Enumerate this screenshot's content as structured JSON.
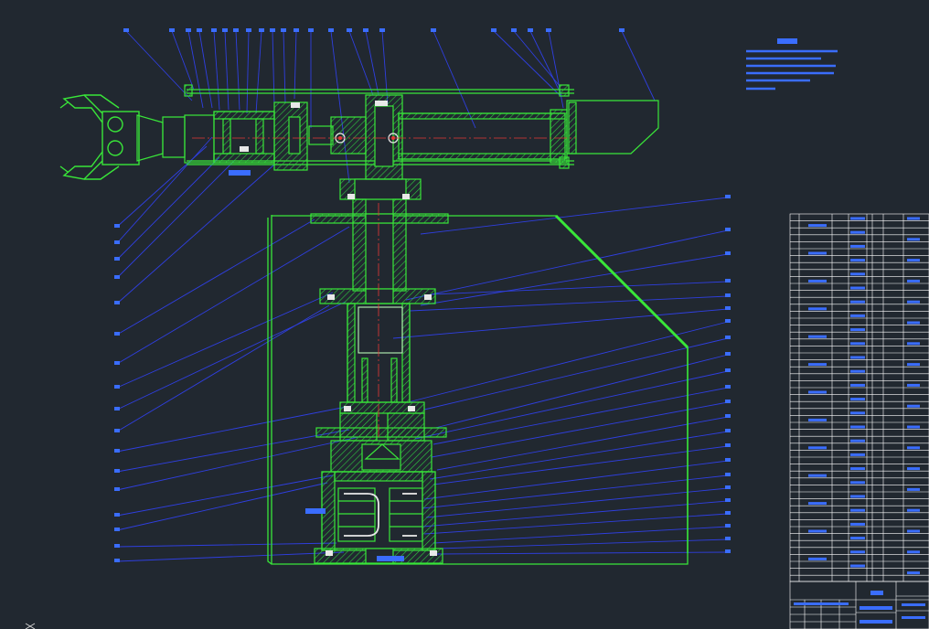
{
  "viewport": {
    "background": "#212830"
  },
  "drawing": {
    "outline_color": "#39e639",
    "leader_color": "#2f3fe0",
    "centerline_color": "#e53935",
    "hatch_color": "#2ecc40",
    "table_line_color": "#ffffff",
    "cursor_icon": "cursor-crosshair-icon"
  }
}
